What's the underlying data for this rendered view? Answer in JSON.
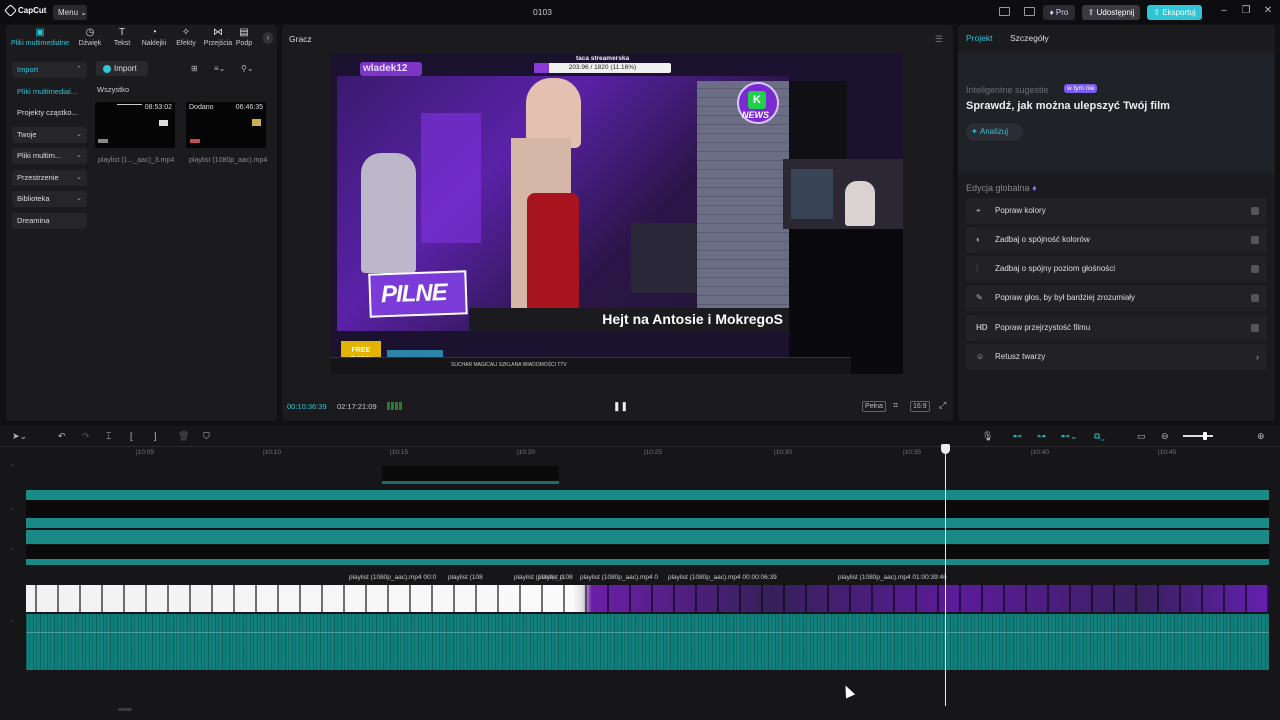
{
  "app": {
    "logo_text": "CapCut",
    "menu_label": "Menu",
    "project_name": "0103",
    "pro_label": "Pro",
    "share_label": "Udostępnij",
    "export_label": "Eksportuj"
  },
  "media": {
    "tabs": [
      {
        "label": "Pliki multimedialne",
        "icon": "media-icon"
      },
      {
        "label": "Dźwięk",
        "icon": "audio-icon"
      },
      {
        "label": "Tekst",
        "icon": "text-icon"
      },
      {
        "label": "Naklejki",
        "icon": "sticker-icon"
      },
      {
        "label": "Efekty",
        "icon": "effects-icon"
      },
      {
        "label": "Przejścia",
        "icon": "transitions-icon"
      },
      {
        "label": "Podp",
        "icon": "captions-icon"
      }
    ],
    "sidebar": [
      {
        "label": "Import"
      },
      {
        "label": "Pliki multimedial..."
      },
      {
        "label": "Projekty cząstko..."
      },
      {
        "label": "Twoje"
      },
      {
        "label": "Pliki multim..."
      },
      {
        "label": "Przestrzenie"
      },
      {
        "label": "Biblioteka"
      },
      {
        "label": "Dreamina"
      }
    ],
    "import_button": "Import",
    "all_label": "Wszystko",
    "items": [
      {
        "duration": "08:53:02",
        "added": "",
        "name": "playlist (1..._aac)_3.mp4"
      },
      {
        "duration": "06:46:35",
        "added": "Dodano",
        "name": "playlist (1080p_aac).mp4"
      }
    ]
  },
  "player": {
    "title": "Gracz",
    "current_time": "00:10:36:39",
    "total_time": "02:17:21:09",
    "full_label": "Pełna",
    "ratio_label": "16:9",
    "video": {
      "streamer_name": "wladek12",
      "goal_title": "taca streamerska",
      "goal_progress": "203.96 / 1820 (11.16%)",
      "news_label": "NEWS",
      "banner": "PILNE",
      "headline": "Hejt na Antosie i MokregoS",
      "case_label": "FREE DAILY CASE",
      "ticker": "SUCHAR MAGICALI SZKLANA WIADOMOŚCI TTV"
    }
  },
  "right": {
    "tab_project": "Projekt",
    "tab_details": "Szczegóły",
    "suggestions_label": "Inteligentne sugestie",
    "suggestions_badge": "w tym nie",
    "suggestions_title": "Sprawdź, jak można ulepszyć Twój film",
    "analyze_label": "Analizuj",
    "global_label": "Edycja globalna",
    "options": [
      {
        "label": "Popraw kolory",
        "icon": "color-icon"
      },
      {
        "label": "Zadbaj o spójność kolorów",
        "icon": "palette-icon"
      },
      {
        "label": "Zadbaj o spójny poziom głośności",
        "icon": "sliders-icon"
      },
      {
        "label": "Popraw głos, by był bardziej zrozumiały",
        "icon": "voice-icon"
      },
      {
        "label": "Popraw przejrzystość filmu",
        "icon": "hd-icon"
      },
      {
        "label": "Retusz twarzy",
        "icon": "face-icon"
      }
    ]
  },
  "timeline": {
    "ruler_labels": [
      "|10:05",
      "|10:10",
      "|10:15",
      "|10:20",
      "|10:25",
      "|10:30",
      "|10:35",
      "|10:40",
      "|10:45"
    ],
    "clip_labels": [
      "playlist (1080p_aac).mp4  00:0",
      "playlist (108",
      "playlist (1080p_a",
      "playlist (108",
      "playlist (1080p_aac).mp4  0",
      "playlist (1080p_aac).mp4  00:00:06:39",
      "playlist (1080p_aac).mp4  01:00:39:46"
    ],
    "zoom_level": 0.75
  }
}
